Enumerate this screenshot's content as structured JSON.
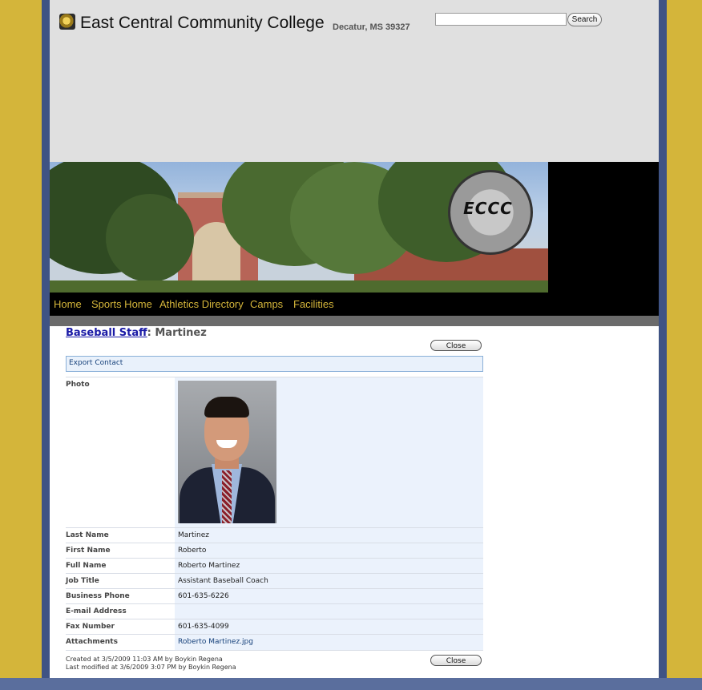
{
  "header": {
    "college_name": "East Central Community College",
    "location": "Decatur, MS  39327",
    "search": {
      "placeholder": "",
      "button_label": "Search"
    }
  },
  "banner": {
    "seal_text": "ECCC",
    "seal_icon": "college-seal"
  },
  "nav": {
    "items": [
      {
        "label": "Home"
      },
      {
        "label": "Sports Home"
      },
      {
        "label": "Athletics Directory"
      },
      {
        "label": "Camps"
      },
      {
        "label": "Facilities"
      }
    ]
  },
  "breadcrumb": {
    "list_link": "Baseball Staff",
    "separator": ": ",
    "item": "Martinez"
  },
  "actions": {
    "close_label": "Close",
    "export_contact": "Export Contact"
  },
  "fields": {
    "photo": {
      "label": "Photo"
    },
    "last_name": {
      "label": "Last Name",
      "value": "Martinez"
    },
    "first_name": {
      "label": "First Name",
      "value": "Roberto"
    },
    "full_name": {
      "label": "Full Name",
      "value": "Roberto Martinez"
    },
    "job_title": {
      "label": "Job Title",
      "value": "Assistant Baseball Coach"
    },
    "business_phone": {
      "label": "Business Phone",
      "value": "601-635-6226"
    },
    "email": {
      "label": "E-mail Address",
      "value": ""
    },
    "fax": {
      "label": "Fax Number",
      "value": "601-635-4099"
    },
    "attachments": {
      "label": "Attachments",
      "value": "Roberto Martinez.jpg"
    }
  },
  "meta": {
    "created": "Created at 3/5/2009 11:03 AM  by Boykin Regena",
    "modified": "Last modified at 3/6/2009 3:07 PM  by Boykin Regena"
  },
  "colors": {
    "side_gold": "#d4b53a",
    "nav_text": "#d4b53a",
    "link_blue": "#1a1aa6",
    "field_value_bg": "#ebf2fc"
  }
}
